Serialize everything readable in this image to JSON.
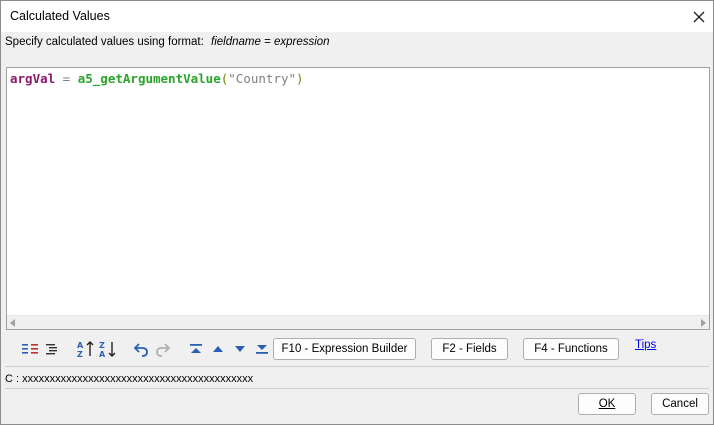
{
  "window": {
    "title": "Calculated Values"
  },
  "instruction": {
    "text": "Specify calculated values using format:",
    "format": "fieldname = expression"
  },
  "editor": {
    "variable": "argVal",
    "operator": " = ",
    "function": "a5_getArgumentValue",
    "open_paren": "(",
    "argument": "\"Country\"",
    "close_paren": ")"
  },
  "toolbar": {
    "expression_builder_label": "F10 - Expression Builder",
    "fields_label": "F2 - Fields",
    "functions_label": "F4 - Functions",
    "tips_label": "Tips"
  },
  "status": {
    "text": "C : xxxxxxxxxxxxxxxxxxxxxxxxxxxxxxxxxxxxxxxxxx"
  },
  "footer": {
    "ok_label": "OK",
    "cancel_label": "Cancel"
  },
  "colors": {
    "variable": "#8b1a6b",
    "function": "#2aa52a",
    "paren": "#808000",
    "string": "#808080",
    "icon_blue": "#2b5fb4"
  }
}
